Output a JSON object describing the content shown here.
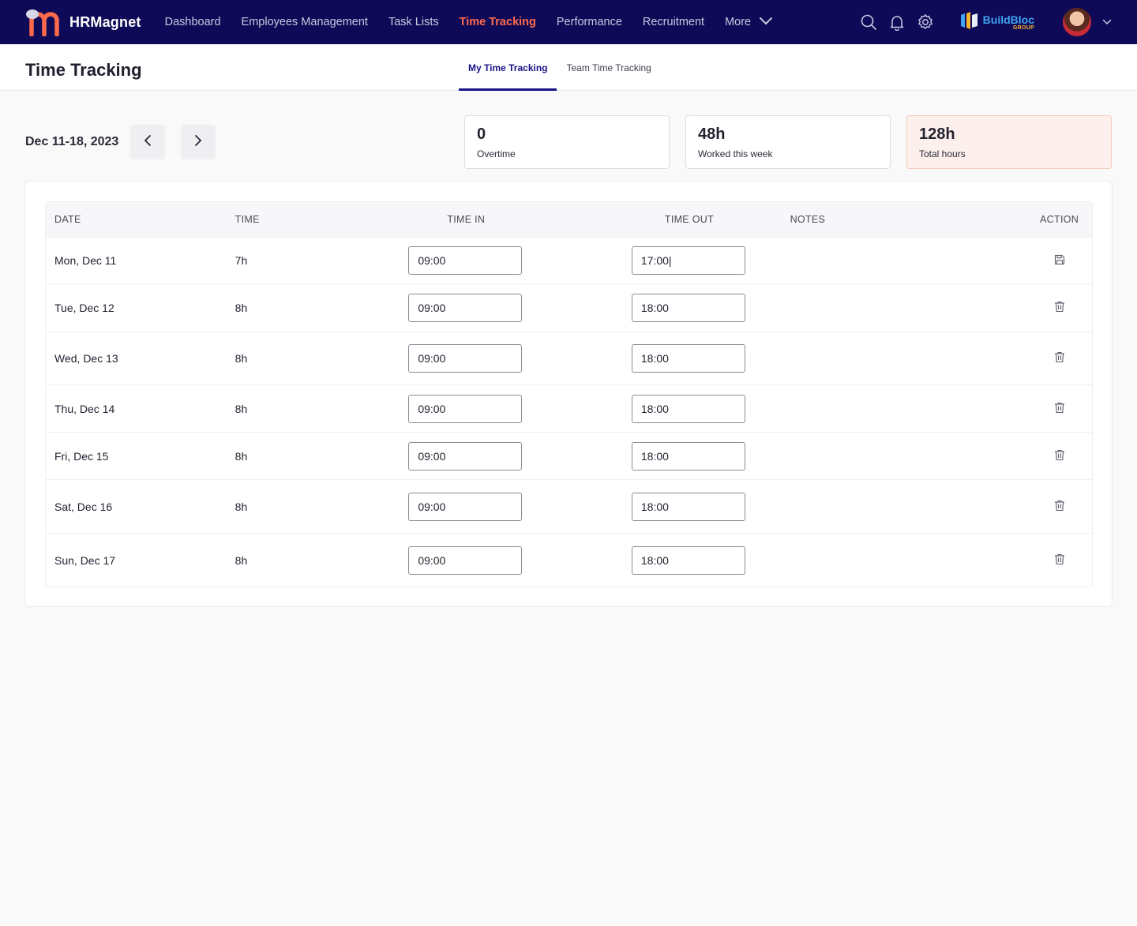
{
  "brand": {
    "name": "HRMagnet"
  },
  "nav": {
    "items": [
      {
        "label": "Dashboard"
      },
      {
        "label": "Employees Management"
      },
      {
        "label": "Task Lists"
      },
      {
        "label": "Time Tracking",
        "active": true
      },
      {
        "label": "Performance"
      },
      {
        "label": "Recruitment"
      }
    ],
    "more_label": "More"
  },
  "company": {
    "name": "BuildBloc",
    "sub": "GROUP"
  },
  "colors": {
    "nav_bg": "#0f0a57",
    "accent": "#ff6a4d",
    "tab_active": "#1a1288",
    "company": "#3fa4f2"
  },
  "page": {
    "title": "Time Tracking",
    "tabs": [
      {
        "label": "My Time Tracking",
        "active": true
      },
      {
        "label": "Team Time Tracking",
        "active": false
      }
    ]
  },
  "week": {
    "label": "Dec 11-18, 2023"
  },
  "stats": [
    {
      "value": "0",
      "label": "Overtime"
    },
    {
      "value": "48h",
      "label": "Worked this week"
    },
    {
      "value": "128h",
      "label": "Total hours"
    }
  ],
  "table": {
    "headers": {
      "date": "DATE",
      "time": "TIME",
      "time_in": "TIME IN",
      "time_out": "TIME OUT",
      "notes": "NOTES",
      "action": "ACTION"
    },
    "rows": [
      {
        "date": "Mon, Dec 11",
        "time": "7h",
        "time_in": "09:00",
        "time_out": "17:00|",
        "action_icon": "save-icon"
      },
      {
        "date": "Tue, Dec 12",
        "time": "8h",
        "time_in": "09:00",
        "time_out": "18:00",
        "action_icon": "trash-icon"
      },
      {
        "date": "Wed, Dec 13",
        "time": "8h",
        "time_in": "09:00",
        "time_out": "18:00",
        "action_icon": "trash-icon"
      },
      {
        "date": "Thu, Dec 14",
        "time": "8h",
        "time_in": "09:00",
        "time_out": "18:00",
        "action_icon": "trash-icon"
      },
      {
        "date": "Fri, Dec 15",
        "time": "8h",
        "time_in": "09:00",
        "time_out": "18:00",
        "action_icon": "trash-icon"
      },
      {
        "date": "Sat, Dec 16",
        "time": "8h",
        "time_in": "09:00",
        "time_out": "18:00",
        "action_icon": "trash-icon"
      },
      {
        "date": "Sun, Dec 17",
        "time": "8h",
        "time_in": "09:00",
        "time_out": "18:00",
        "action_icon": "trash-icon"
      }
    ]
  }
}
